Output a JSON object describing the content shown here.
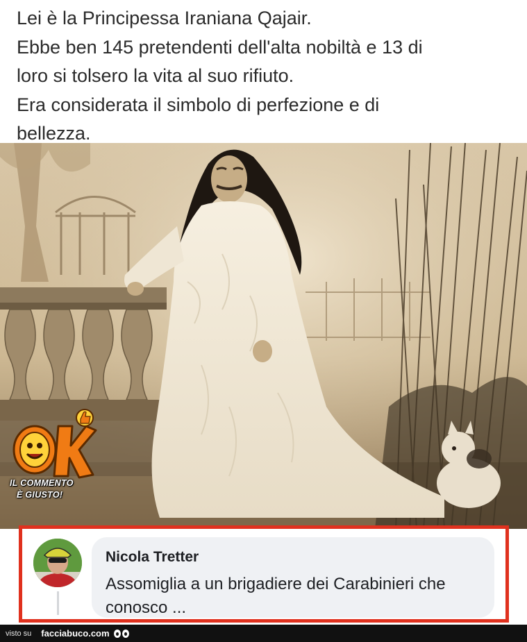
{
  "caption": {
    "lines": [
      "Lei è la Principessa Iraniana Qajair.",
      "Ebbe ben 145 pretendenti dell'alta nobiltà e 13 di",
      "loro si tolsero la vita al suo rifiuto.",
      "Era considerata il simbolo di perfezione e di",
      "bellezza."
    ]
  },
  "badge": {
    "logo": "OK",
    "line1": "IL COMMENTO",
    "line2": "È GIUSTO!",
    "icon": "thumbs-up-icon"
  },
  "comment": {
    "author": "Nicola Tretter",
    "text": "Assomiglia a un brigadiere dei Carabinieri che conosco ...",
    "highlight_color": "#e0311e"
  },
  "footer": {
    "visto_su": "visto su",
    "brand": "facciabuco.com"
  },
  "colors": {
    "sepia_light": "#e6d6bb",
    "sepia_dark": "#6b5a43",
    "bubble": "#eff1f4"
  }
}
